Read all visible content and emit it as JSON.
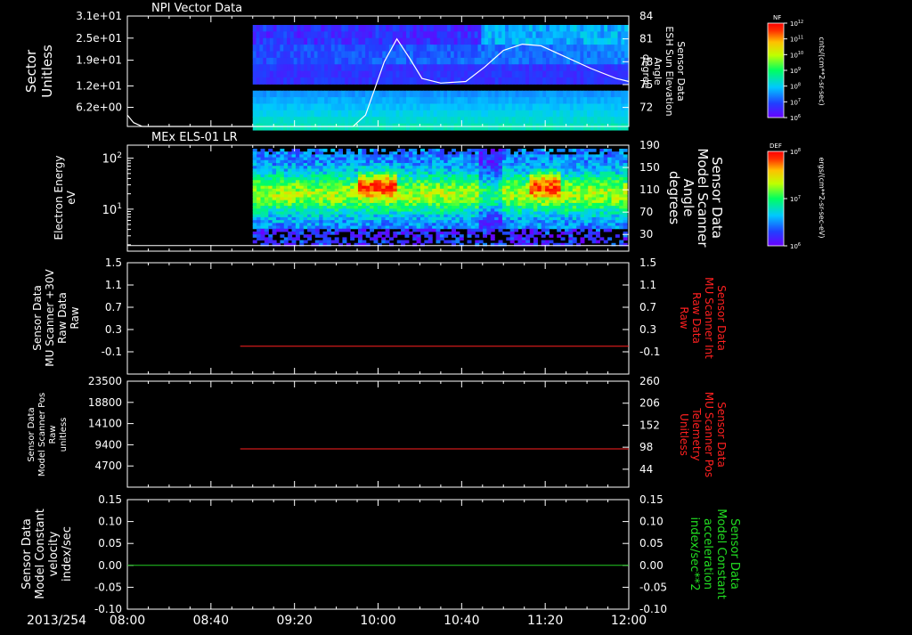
{
  "colors": {
    "background": "#000000",
    "axis": "#ffffff",
    "right_label_red": "#ff2020",
    "right_label_green": "#22dd22",
    "trace_red": "#ff2020",
    "trace_green": "#22cc22",
    "trace_white": "#ffffff"
  },
  "time_axis": {
    "prefix": "2013/254",
    "ticks": [
      "08:00",
      "08:40",
      "09:20",
      "10:00",
      "10:40",
      "11:20",
      "12:00"
    ],
    "range_hours": [
      8.0,
      12.0
    ]
  },
  "chart_data": [
    {
      "type": "heatmap",
      "id": "panel1",
      "title": "NPI Vector Data",
      "ylabel_lines": [
        "Sector",
        "Unitless"
      ],
      "yticks": [
        "3.1e+01",
        "2.5e+01",
        "1.9e+01",
        "1.2e+01",
        "6.2e+00"
      ],
      "ytick_values": [
        31,
        25,
        19,
        12,
        6.2
      ],
      "ylim": [
        1,
        31
      ],
      "data_start_time": 9.0,
      "right_axis": {
        "label_lines": [
          "Sensor Data",
          "ESH Sun Elevation",
          "Angle",
          "degree"
        ],
        "ticks": [
          "84",
          "81",
          "78",
          "75",
          "72"
        ],
        "tick_values": [
          84,
          81,
          78,
          75,
          72
        ],
        "ylim": [
          69.5,
          84
        ]
      },
      "overlay_line": {
        "x": [
          8.0,
          8.05,
          8.12,
          9.0,
          9.8,
          9.9,
          10.05,
          10.15,
          10.25,
          10.35,
          10.5,
          10.7,
          10.85,
          11.0,
          11.15,
          11.3,
          11.5,
          11.7,
          11.9,
          12.0
        ],
        "y": [
          71.0,
          70.0,
          69.5,
          69.5,
          69.5,
          71.0,
          78.0,
          81.0,
          78.5,
          75.8,
          75.2,
          75.4,
          77.3,
          79.5,
          80.3,
          80.1,
          78.6,
          77.1,
          75.8,
          75.4
        ]
      },
      "colorbar": {
        "name": "NF",
        "ticks": [
          "10^12",
          "10^11",
          "10^10",
          "10^9",
          "10^8",
          "10^7",
          "10^6"
        ],
        "unit": "cnts/(cm**2-sr-sec)"
      }
    },
    {
      "type": "heatmap",
      "id": "panel2",
      "title": "MEx ELS-01 LR",
      "ylabel_lines": [
        "Electron Energy",
        "eV"
      ],
      "yticks": [
        "10^2",
        "10^1"
      ],
      "ylog": true,
      "ylim": [
        1.5,
        180
      ],
      "data_start_time": 9.0,
      "right_axis": {
        "label_lines": [
          "Sensor Data",
          "Model Scanner",
          "Angle",
          "degrees"
        ],
        "ticks": [
          "190",
          "150",
          "110",
          "70",
          "30"
        ],
        "tick_values": [
          190,
          150,
          110,
          70,
          30
        ],
        "ylim": [
          0,
          190
        ]
      },
      "overlay_line": {
        "x": [
          8.0,
          12.0
        ],
        "y": [
          10,
          10
        ]
      },
      "colorbar": {
        "name": "DEF",
        "ticks": [
          "10^8",
          "10^7",
          "10^6"
        ],
        "unit": "ergs/(cm**2-sr-sec-eV)"
      }
    },
    {
      "type": "line",
      "id": "panel3",
      "ylabel_lines": [
        "Sensor Data",
        "MU Scanner +30V",
        "Raw Data",
        "Raw"
      ],
      "yticks": [
        "1.5",
        "1.1",
        "0.7",
        "0.3",
        "-0.1"
      ],
      "ytick_values": [
        1.5,
        1.1,
        0.7,
        0.3,
        -0.1
      ],
      "ylim": [
        -0.5,
        1.5
      ],
      "right_axis": {
        "label_lines": [
          "Sensor Data",
          "MU Scanner Int",
          "Raw Data",
          "Raw"
        ],
        "ticks": [
          "1.5",
          "1.1",
          "0.7",
          "0.3",
          "-0.1"
        ],
        "tick_values": [
          1.5,
          1.1,
          0.7,
          0.3,
          -0.1
        ],
        "ylim": [
          -0.5,
          1.5
        ]
      },
      "series": [
        {
          "x": [
            8.9,
            12.0
          ],
          "y": [
            0.0,
            0.0
          ]
        }
      ]
    },
    {
      "type": "line",
      "id": "panel4",
      "ylabel_lines": [
        "Sensor Data",
        "Model Scanner Pos",
        "Raw",
        "unitless"
      ],
      "yticks": [
        "23500",
        "18800",
        "14100",
        "9400",
        "4700"
      ],
      "ytick_values": [
        23500,
        18800,
        14100,
        9400,
        4700
      ],
      "ylim": [
        0,
        23500
      ],
      "right_axis": {
        "label_lines": [
          "Sensor Data",
          "MU Scanner Pos",
          "Telemetry",
          "Unitless"
        ],
        "ticks": [
          "260",
          "206",
          "152",
          "98",
          "44"
        ],
        "tick_values": [
          260,
          206,
          152,
          98,
          44
        ],
        "ylim": [
          0,
          260
        ]
      },
      "series": [
        {
          "x": [
            8.9,
            12.0
          ],
          "y": [
            8500,
            8500
          ]
        }
      ]
    },
    {
      "type": "line",
      "id": "panel5",
      "ylabel_lines": [
        "Sensor Data",
        "Model Constant",
        "velocity",
        "index/sec"
      ],
      "yticks": [
        "0.15",
        "0.10",
        "0.05",
        "0.00",
        "-0.05",
        "-0.10"
      ],
      "ytick_values": [
        0.15,
        0.1,
        0.05,
        0.0,
        -0.05,
        -0.1
      ],
      "ylim": [
        -0.1,
        0.15
      ],
      "right_axis": {
        "label_lines": [
          "Sensor Data",
          "Model Constant",
          "acceleration",
          "index/sec**2"
        ],
        "ticks": [
          "0.15",
          "0.10",
          "0.05",
          "0.00",
          "-0.05",
          "-0.10"
        ],
        "tick_values": [
          0.15,
          0.1,
          0.05,
          0.0,
          -0.05,
          -0.1
        ],
        "ylim": [
          -0.1,
          0.15
        ]
      },
      "series": [
        {
          "x": [
            8.0,
            12.0
          ],
          "y": [
            0.0,
            0.0
          ]
        }
      ]
    }
  ]
}
